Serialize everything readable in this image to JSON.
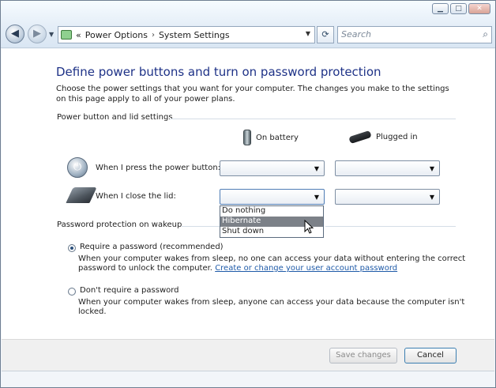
{
  "nav": {
    "breadcrumb_prefix": "«",
    "breadcrumb": [
      "Power Options",
      "System Settings"
    ],
    "breadcrumb_sep": "›",
    "search_placeholder": "Search"
  },
  "page": {
    "title": "Define power buttons and turn on password protection",
    "description": "Choose the power settings that you want for your computer. The changes you make to the settings on this page apply to all of your power plans."
  },
  "power_group": {
    "label": "Power button and lid settings",
    "col_battery": "On battery",
    "col_plugged": "Plugged in",
    "rows": [
      {
        "label": "When I press the power button:",
        "battery_value": "",
        "plugged_value": ""
      },
      {
        "label": "When I close the lid:",
        "battery_value": "",
        "plugged_value": ""
      }
    ]
  },
  "lid_dropdown": {
    "options": [
      "Do nothing",
      "Hibernate",
      "Shut down"
    ],
    "highlighted": "Hibernate"
  },
  "password_group": {
    "label": "Password protection on wakeup",
    "options": [
      {
        "label": "Require a password (recommended)",
        "checked": true,
        "desc_line1": "When your computer wakes from sleep, no one can access your data without entering the correct",
        "desc_line2": "password to unlock the computer.",
        "link": "Create or change your user account password"
      },
      {
        "label": "Don't require a password",
        "checked": false,
        "desc_line1": "When your computer wakes from sleep, anyone can access your data because the computer isn't",
        "desc_line2": "locked."
      }
    ]
  },
  "footer": {
    "save_label": "Save changes",
    "cancel_label": "Cancel"
  }
}
